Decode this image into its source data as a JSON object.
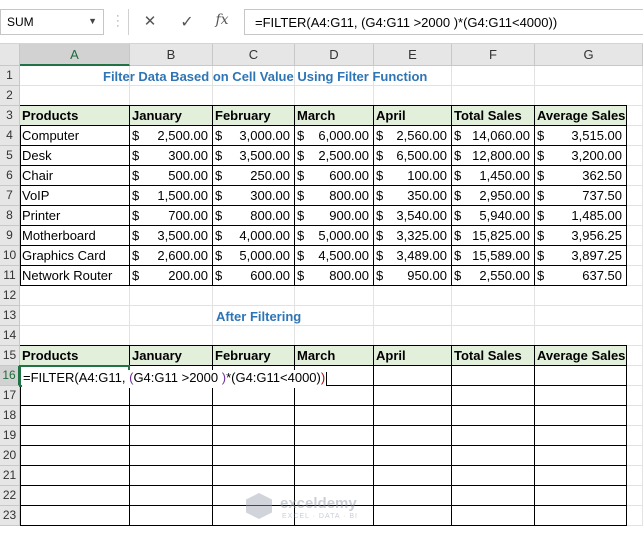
{
  "name_box": "SUM",
  "formula": "=FILTER(A4:G11, (G4:G11 >2000 )*(G4:G11<4000))",
  "columns": [
    "A",
    "B",
    "C",
    "D",
    "E",
    "F",
    "G"
  ],
  "rows": [
    "1",
    "2",
    "3",
    "4",
    "5",
    "6",
    "7",
    "8",
    "9",
    "10",
    "11",
    "12",
    "13",
    "14",
    "15",
    "16",
    "17",
    "18",
    "19",
    "20",
    "21",
    "22",
    "23"
  ],
  "title": "Filter Data Based on Cell Value Using Filter Function",
  "after_title": "After Filtering",
  "headers": [
    "Products",
    "January",
    "February",
    "March",
    "April",
    "Total Sales",
    "Average Sales"
  ],
  "table": [
    [
      "Computer",
      "2,500.00",
      "3,000.00",
      "6,000.00",
      "2,560.00",
      "14,060.00",
      "3,515.00"
    ],
    [
      "Desk",
      "300.00",
      "3,500.00",
      "2,500.00",
      "6,500.00",
      "12,800.00",
      "3,200.00"
    ],
    [
      "Chair",
      "500.00",
      "250.00",
      "600.00",
      "100.00",
      "1,450.00",
      "362.50"
    ],
    [
      "VoIP",
      "1,500.00",
      "300.00",
      "800.00",
      "350.00",
      "2,950.00",
      "737.50"
    ],
    [
      "Printer",
      "700.00",
      "800.00",
      "900.00",
      "3,540.00",
      "5,940.00",
      "1,485.00"
    ],
    [
      "Motherboard",
      "3,500.00",
      "4,000.00",
      "5,000.00",
      "3,325.00",
      "15,825.00",
      "3,956.25"
    ],
    [
      "Graphics Card",
      "2,600.00",
      "5,000.00",
      "4,500.00",
      "3,489.00",
      "15,589.00",
      "3,897.25"
    ],
    [
      "Network Router",
      "200.00",
      "600.00",
      "800.00",
      "950.00",
      "2,550.00",
      "637.50"
    ]
  ],
  "currency_symbol": "$",
  "editing_parts": [
    "=FILTER(A4:G11, ",
    "(",
    "G4:G11 >2000 ",
    ")",
    "*(G4:G11<4000)",
    ")"
  ],
  "watermark": {
    "name": "exceldemy",
    "tag": "EXCEL · DATA · BI"
  },
  "colors": {
    "accent": "#217346",
    "title": "#2e75b6",
    "header_fill": "#e2efda"
  }
}
